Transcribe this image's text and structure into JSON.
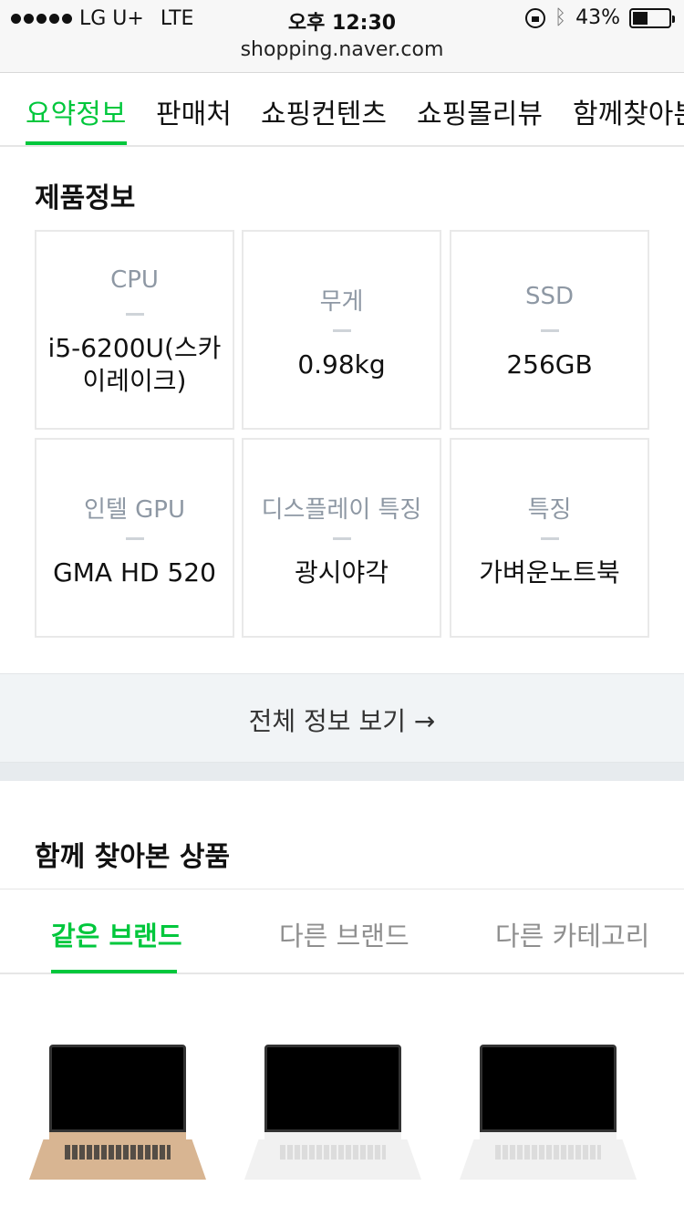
{
  "status_bar": {
    "carrier": "LG U+",
    "network": "LTE",
    "time": "오후 12:30",
    "battery_percent": "43%",
    "battery_level": 0.43
  },
  "url": "shopping.naver.com",
  "top_tabs": [
    "요약정보",
    "판매처",
    "쇼핑컨텐츠",
    "쇼핑몰리뷰",
    "함께찾아본"
  ],
  "product_info": {
    "title": "제품정보",
    "specs": [
      {
        "label": "CPU",
        "value": "i5-6200U(스카이레이크)"
      },
      {
        "label": "무게",
        "value": "0.98kg"
      },
      {
        "label": "SSD",
        "value": "256GB"
      },
      {
        "label": "인텔 GPU",
        "value": "GMA HD 520"
      },
      {
        "label": "디스플레이 특징",
        "value": "광시야각"
      },
      {
        "label": "특징",
        "value": "가벼운노트북"
      }
    ],
    "view_all": "전체 정보 보기 →"
  },
  "related": {
    "title": "함께 찾아본 상품",
    "tabs": [
      "같은 브랜드",
      "다른 브랜드",
      "다른 카테고리"
    ],
    "products": [
      {
        "image": "laptop-gold"
      },
      {
        "image": "laptop-white"
      },
      {
        "image": "laptop-white"
      }
    ]
  },
  "colors": {
    "accent": "#00c73c"
  }
}
